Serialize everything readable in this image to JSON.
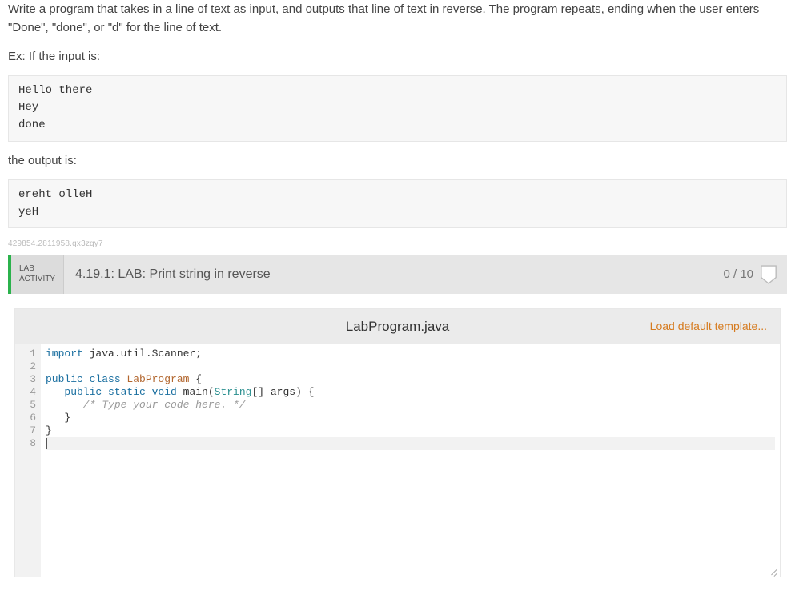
{
  "problem": {
    "desc": "Write a program that takes in a line of text as input, and outputs that line of text in reverse. The program repeats, ending when the user enters \"Done\", \"done\", or \"d\" for the line of text.",
    "ex_label": "Ex: If the input is:",
    "input_example": "Hello there\nHey\ndone",
    "output_label": "the output is:",
    "output_example": "ereht olleH\nyeH"
  },
  "meta_id": "429854.2811958.qx3zqy7",
  "lab": {
    "badge_line1": "LAB",
    "badge_line2": "ACTIVITY",
    "title": "4.19.1: LAB: Print string in reverse",
    "score": "0 / 10"
  },
  "editor": {
    "filename": "LabProgram.java",
    "template_link": "Load default template...",
    "line_count": 8,
    "code": {
      "l1_import": "import",
      "l1_rest": " java.util.Scanner;",
      "l3_pub": "public",
      "l3_class": " class",
      "l3_name": " LabProgram",
      "l3_brace": " {",
      "l4_indent": "   ",
      "l4_pub": "public",
      "l4_static": " static",
      "l4_void": " void",
      "l4_main": " main(",
      "l4_string": "String",
      "l4_args": "[] args) {",
      "l5_indent": "      ",
      "l5_comment": "/* Type your code here. */",
      "l6": "   }",
      "l7": "}"
    }
  }
}
